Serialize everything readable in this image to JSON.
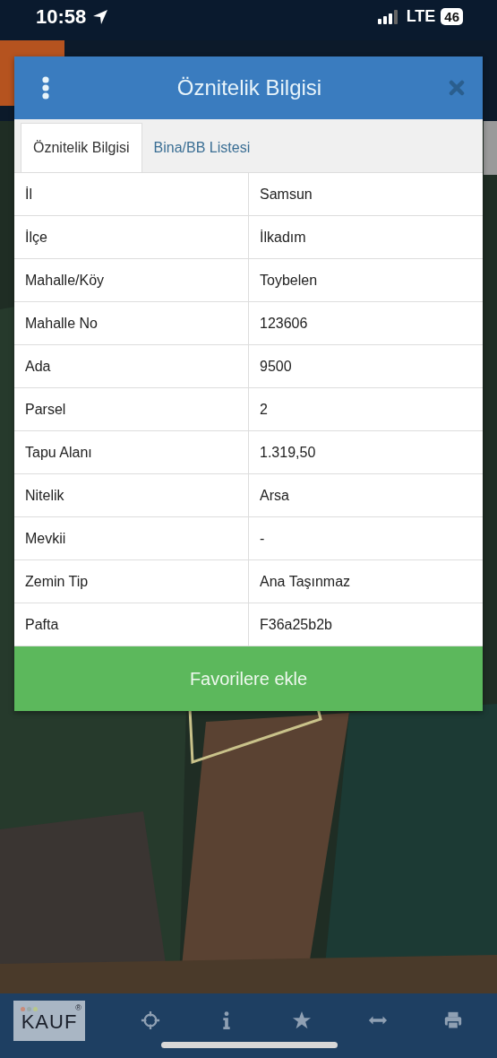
{
  "status_bar": {
    "time": "10:58",
    "network": "LTE",
    "battery": "46"
  },
  "dialog": {
    "title": "Öznitelik Bilgisi",
    "tabs": [
      {
        "label": "Öznitelik Bilgisi",
        "selected": true
      },
      {
        "label": "Bina/BB Listesi",
        "selected": false
      }
    ],
    "rows": [
      {
        "label": "İl",
        "value": "Samsun"
      },
      {
        "label": "İlçe",
        "value": "İlkadım"
      },
      {
        "label": "Mahalle/Köy",
        "value": "Toybelen"
      },
      {
        "label": "Mahalle No",
        "value": "123606"
      },
      {
        "label": "Ada",
        "value": "9500"
      },
      {
        "label": "Parsel",
        "value": "2"
      },
      {
        "label": "Tapu Alanı",
        "value": "1.319,50"
      },
      {
        "label": "Nitelik",
        "value": "Arsa"
      },
      {
        "label": "Mevkii",
        "value": "-"
      },
      {
        "label": "Zemin Tip",
        "value": "Ana Taşınmaz"
      },
      {
        "label": "Pafta",
        "value": "F36a25b2b"
      }
    ],
    "button": "Favorilere ekle"
  },
  "bottom_nav": {
    "logo": "KAUF",
    "logo_mark": "®",
    "items": [
      {
        "kind": "crosshair"
      },
      {
        "kind": "info"
      },
      {
        "kind": "star"
      },
      {
        "kind": "arrows"
      },
      {
        "kind": "printer"
      }
    ]
  }
}
